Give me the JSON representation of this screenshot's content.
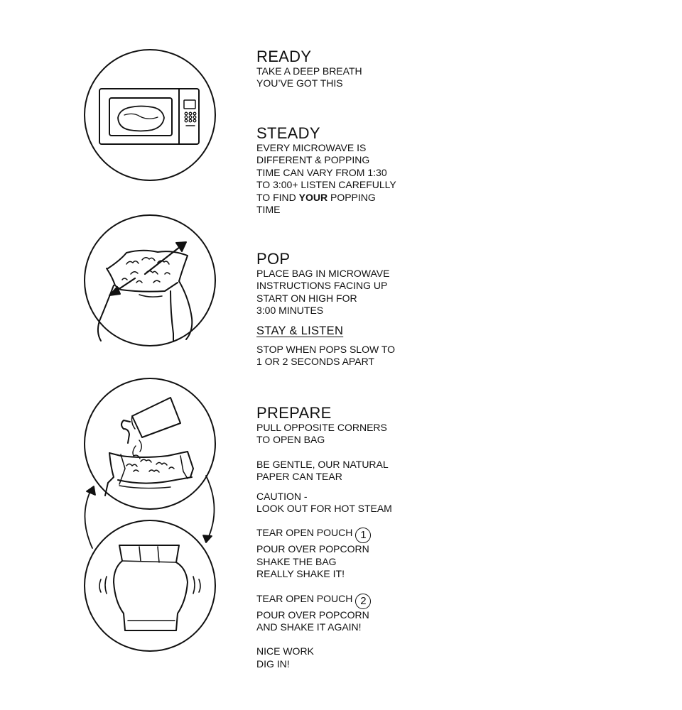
{
  "sections": {
    "ready": {
      "title": "READY",
      "lines": "TAKE A DEEP BREATH\nYOU’VE GOT THIS"
    },
    "steady": {
      "title": "STEADY",
      "lines_before": "EVERY MICROWAVE IS\nDIFFERENT & POPPING\nTIME CAN VARY FROM 1:30\nTO 3:00+ LISTEN CAREFULLY\nTO FIND ",
      "emphasis": "YOUR",
      "lines_after": " POPPING\nTIME"
    },
    "pop": {
      "title": "POP",
      "lines": "PLACE BAG IN MICROWAVE\nINSTRUCTIONS FACING UP\nSTART ON HIGH FOR\n3:00 MINUTES",
      "subtitle": "STAY & LISTEN",
      "stop": "STOP WHEN POPS SLOW TO\n1 OR 2 SECONDS APART"
    },
    "prepare": {
      "title": "PREPARE",
      "open": "PULL OPPOSITE CORNERS\nTO OPEN BAG",
      "gentle": "BE GENTLE, OUR NATURAL\nPAPER CAN TEAR",
      "caution": "CAUTION -\nLOOK OUT FOR HOT STEAM",
      "pouch1_label": "TEAR OPEN POUCH",
      "pouch1_num": "1",
      "pouch1_lines": "POUR OVER POPCORN\nSHAKE THE BAG\nREALLY SHAKE IT!",
      "pouch2_label": "TEAR OPEN POUCH",
      "pouch2_num": "2",
      "pouch2_lines": "POUR OVER POPCORN\nAND SHAKE IT AGAIN!",
      "done": "NICE WORK\nDIG IN!"
    }
  },
  "icons": [
    "microwave-icon",
    "open-bag-icon",
    "pour-pouch-icon",
    "shake-bag-icon",
    "cycle-arrows-icon"
  ]
}
